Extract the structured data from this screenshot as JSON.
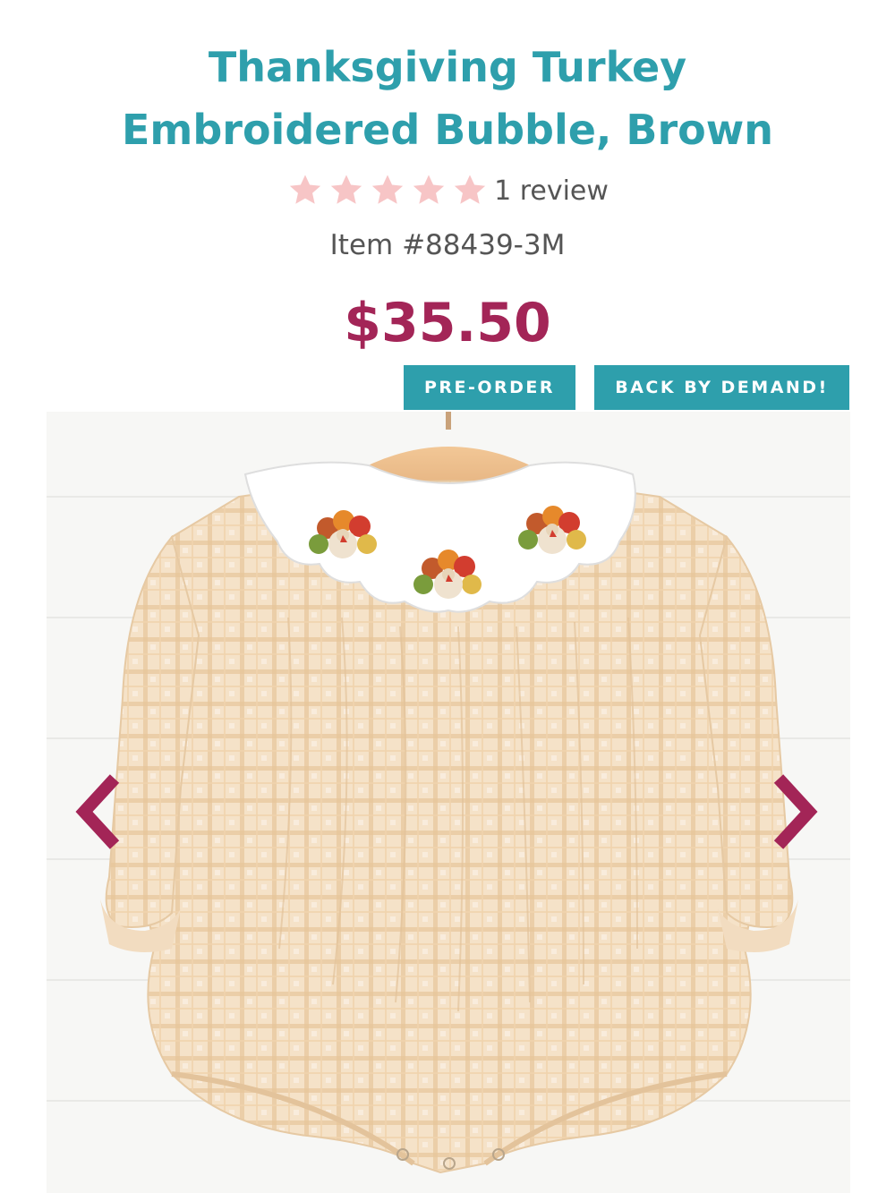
{
  "product": {
    "title_line1": "Thanksgiving Turkey",
    "title_line2": "Embroidered Bubble, Brown",
    "rating": {
      "stars": 5,
      "max_stars": 5,
      "review_text": "1 review"
    },
    "item_number": "Item #88439-3M",
    "price": "$35.50",
    "badges": {
      "preorder": "PRE-ORDER",
      "back_by_demand": "BACK BY DEMAND!"
    }
  },
  "gallery": {
    "prev_icon": "chevron-left-icon",
    "next_icon": "chevron-right-icon"
  },
  "colors": {
    "title": "#2e9fac",
    "price": "#a32557",
    "badge_bg": "#2e9fac",
    "star": "#f7c5c6",
    "arrow": "#a32557"
  }
}
